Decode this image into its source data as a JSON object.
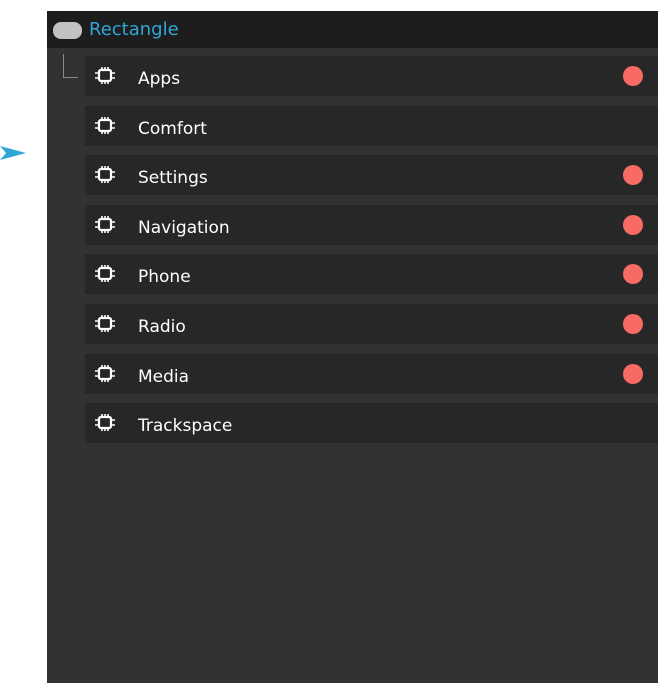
{
  "colors": {
    "accent": "#2fa7d6",
    "status_dot": "#f76b63",
    "panel_background": "#323232",
    "row_background": "#272727",
    "header_background": "#1d1d1d"
  },
  "header": {
    "title": "Rectangle",
    "toggle_icon": "toggle-icon"
  },
  "pointer_icon": "arrow-right-icon",
  "rows": [
    {
      "label": "Apps",
      "icon": "module-icon",
      "has_status_dot": true
    },
    {
      "label": "Comfort",
      "icon": "module-icon",
      "has_status_dot": false
    },
    {
      "label": "Settings",
      "icon": "module-icon",
      "has_status_dot": true
    },
    {
      "label": "Navigation",
      "icon": "module-icon",
      "has_status_dot": true
    },
    {
      "label": "Phone",
      "icon": "module-icon",
      "has_status_dot": true
    },
    {
      "label": "Radio",
      "icon": "module-icon",
      "has_status_dot": true
    },
    {
      "label": "Media",
      "icon": "module-icon",
      "has_status_dot": true
    },
    {
      "label": "Trackspace",
      "icon": "module-icon",
      "has_status_dot": false
    }
  ]
}
